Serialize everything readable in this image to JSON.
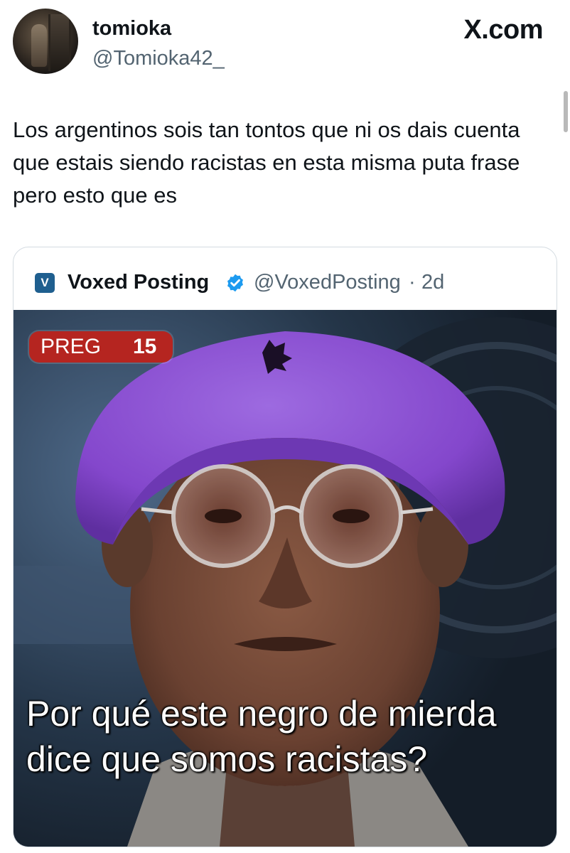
{
  "tweet": {
    "author_name": "tomioka",
    "author_handle": "@Tomioka42_",
    "brand": "X.com",
    "text": "Los argentinos sois tan tontos que ni os dais cuenta que estais siendo racistas en esta misma puta frase pero esto que es"
  },
  "quote": {
    "avatar_letter": "V",
    "author_name": "Voxed Posting",
    "author_handle": "@VoxedPosting",
    "separator": "·",
    "time": "2d",
    "media": {
      "badge_label": "PREG",
      "badge_number": "15",
      "caption": "Por qué este negro de mierda dice que somos racistas?"
    }
  },
  "colors": {
    "text": "#0f1419",
    "secondary_text": "#536471",
    "verified_blue": "#1d9bf0",
    "badge_red": "#b52520",
    "hat_purple": "#8a4fd0"
  },
  "icons": {
    "verified": "verified-check-icon",
    "brand": "x-logo"
  }
}
